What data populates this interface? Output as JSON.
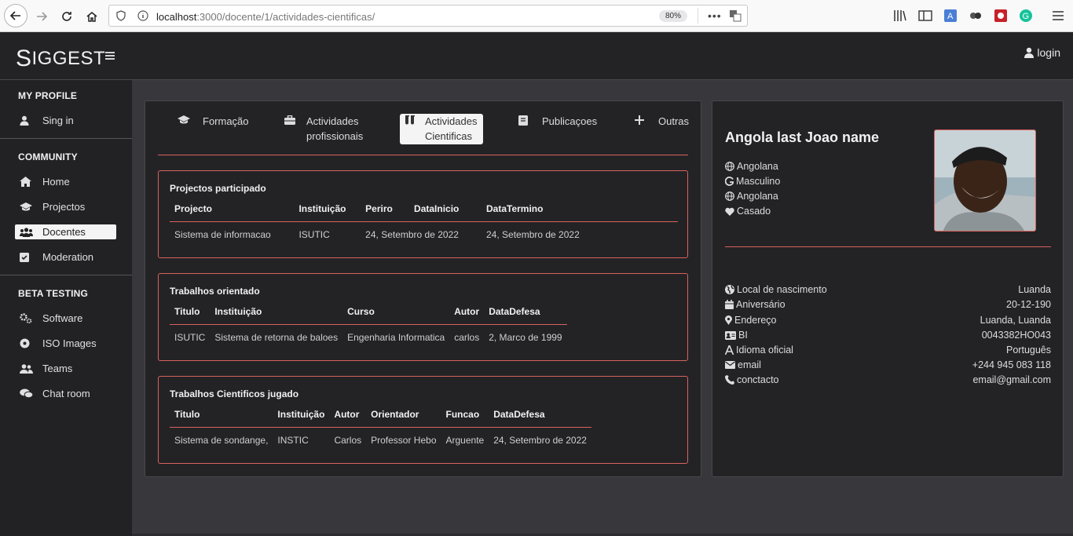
{
  "browser": {
    "url_host": "localhost",
    "url_rest": ":3000/docente/1/actividades-cientificas/",
    "zoom": "80%"
  },
  "app": {
    "logo_s": "S",
    "logo_rest": "IGGEST",
    "login": "login"
  },
  "sidebar": {
    "my_profile_title": "MY PROFILE",
    "sign_in": "Sing in",
    "community_title": "COMMUNITY",
    "home": "Home",
    "projectos": "Projectos",
    "docentes": "Docentes",
    "moderation": "Moderation",
    "beta_title": "BETA TESTING",
    "software": "Software",
    "iso": "ISO Images",
    "teams": "Teams",
    "chat": "Chat room"
  },
  "tabs": {
    "formacao": "Formação",
    "prof_1": "Actividades",
    "prof_2": "profissionais",
    "cient_1": "Actividades",
    "cient_2": "Cientificas",
    "publicacoes": "Publicaçoes",
    "outras": "Outras"
  },
  "projectos": {
    "title": "Projectos participado",
    "headers": [
      "Projecto",
      "Instituição",
      "Periro",
      "DataInicio",
      "DataTermino"
    ],
    "row": [
      "Sistema de informacao",
      "ISUTIC",
      "24, Setembro de 2022",
      "24, Setembro de 2022"
    ]
  },
  "trabalhos": {
    "title": "Trabalhos orientado",
    "headers": [
      "Titulo",
      "Instituição",
      "Curso",
      "Autor",
      "DataDefesa"
    ],
    "row": [
      "ISUTIC",
      "Sistema de retorna de baloes",
      "Engenharia Informatica",
      "carlos",
      "2, Marco de 1999"
    ]
  },
  "jugado": {
    "title": "Trabalhos Cientificos jugado",
    "headers": [
      "Titulo",
      "Instituição",
      "Autor",
      "Orientador",
      "Funcao",
      "DataDefesa"
    ],
    "row": [
      "Sistema de sondange,",
      "INSTIC",
      "Carlos",
      "Professor Hebo",
      "Arguente",
      "24, Setembro de 2022"
    ]
  },
  "profile": {
    "name": "Angola last Joao name",
    "nacionalidade": "Angolana",
    "genero": "Masculino",
    "naturalidade": "Angolana",
    "estado_civil": "Casado",
    "details": [
      {
        "label": "Local de nascimento",
        "value": "Luanda"
      },
      {
        "label": "Aniversário",
        "value": "20-12-190"
      },
      {
        "label": "Endereço",
        "value": "Luanda, Luanda"
      },
      {
        "label": "BI",
        "value": "0043382HO043"
      },
      {
        "label": "Idioma oficial",
        "value": "Português"
      },
      {
        "label": "email",
        "value": "+244 945 083 118"
      },
      {
        "label": "conctacto",
        "value": "email@gmail.com"
      }
    ]
  },
  "colors": {
    "accent": "#d8625c",
    "dark": "#232326",
    "bg": "#38383c"
  }
}
